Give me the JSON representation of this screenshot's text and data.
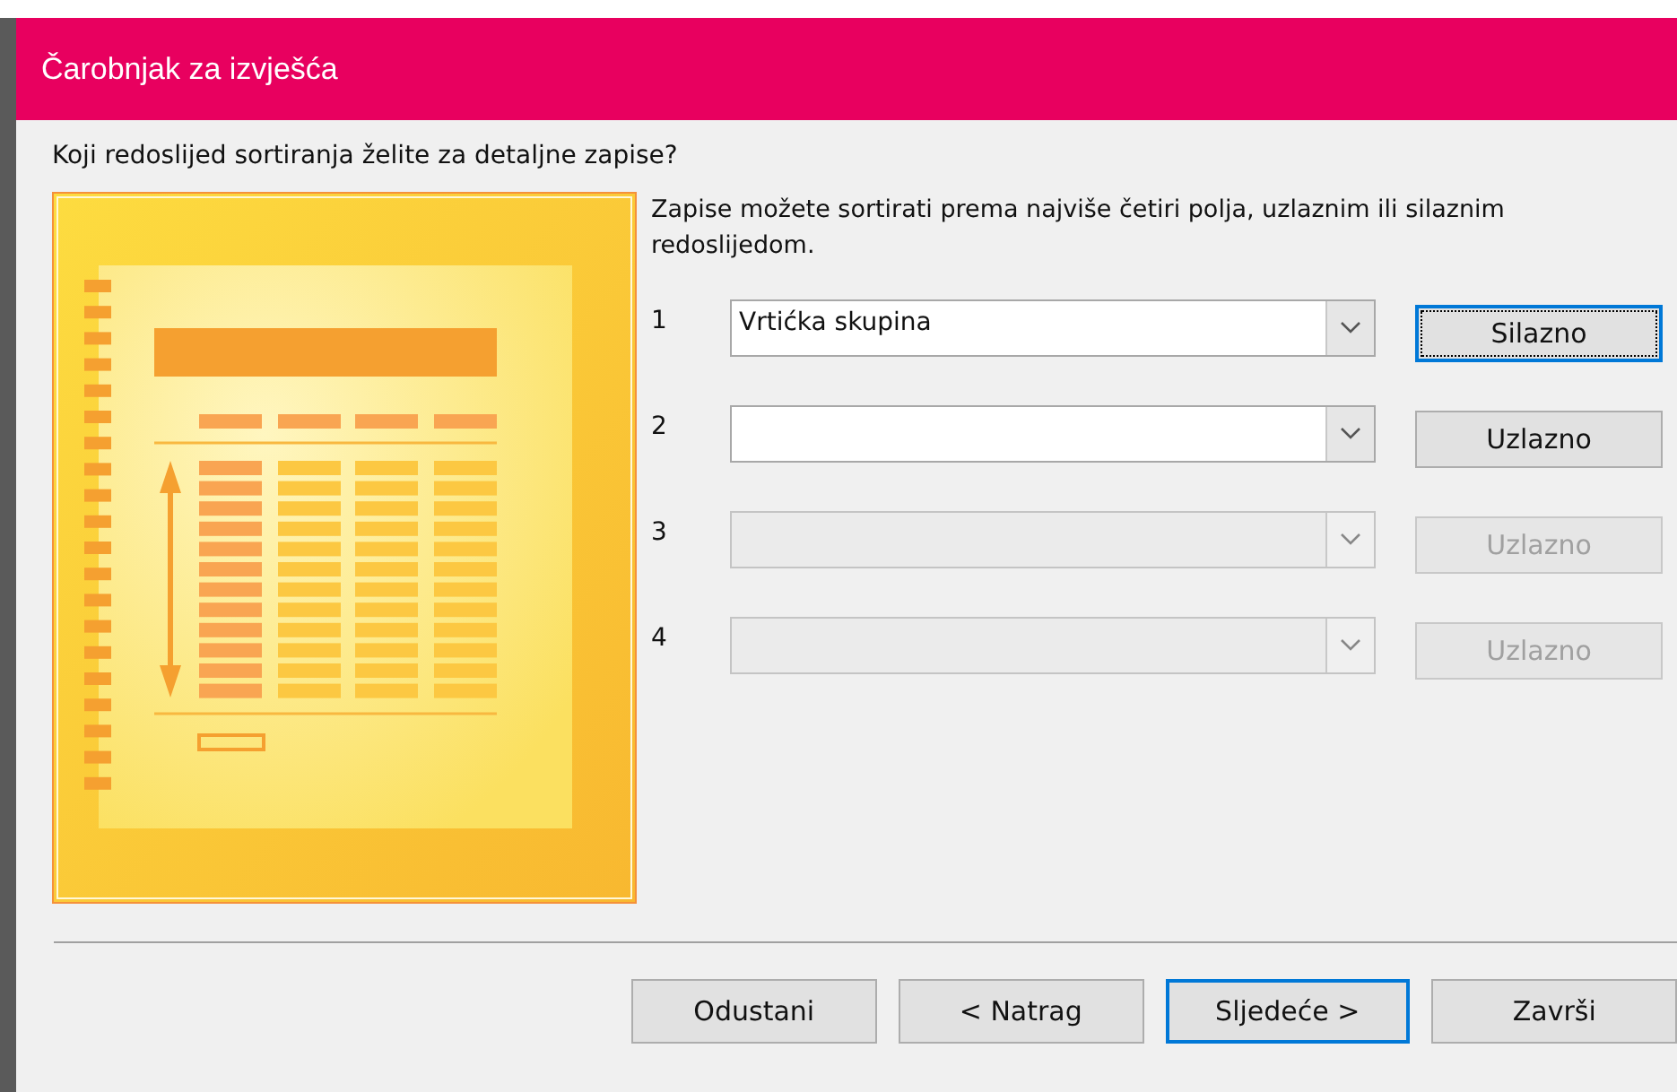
{
  "window": {
    "title": "Čarobnjak za izvješća"
  },
  "question": "Koji redoslijed sortiranja želite za detaljne zapise?",
  "description": "Zapise možete sortirati prema najviše četiri polja, uzlaznim ili silaznim redoslijedom.",
  "sort_rows": [
    {
      "number": "1",
      "value": "Vrtićka skupina",
      "disabled": false,
      "order_button": {
        "label": "Silazno",
        "disabled": false,
        "focused": true
      }
    },
    {
      "number": "2",
      "disabled": false,
      "order_button": {
        "label": "Uzlazno",
        "disabled": false,
        "focused": false
      }
    },
    {
      "number": "3",
      "disabled": true,
      "order_button": {
        "label": "Uzlazno",
        "disabled": true,
        "focused": false
      }
    },
    {
      "number": "4",
      "disabled": true,
      "order_button": {
        "label": "Uzlazno",
        "disabled": true,
        "focused": false
      }
    }
  ],
  "buttons": [
    {
      "label": "Odustani",
      "default": false
    },
    {
      "label": "< Natrag",
      "default": false
    },
    {
      "label": "Sljedeće >",
      "default": true
    },
    {
      "label": "Završi",
      "default": false
    }
  ]
}
